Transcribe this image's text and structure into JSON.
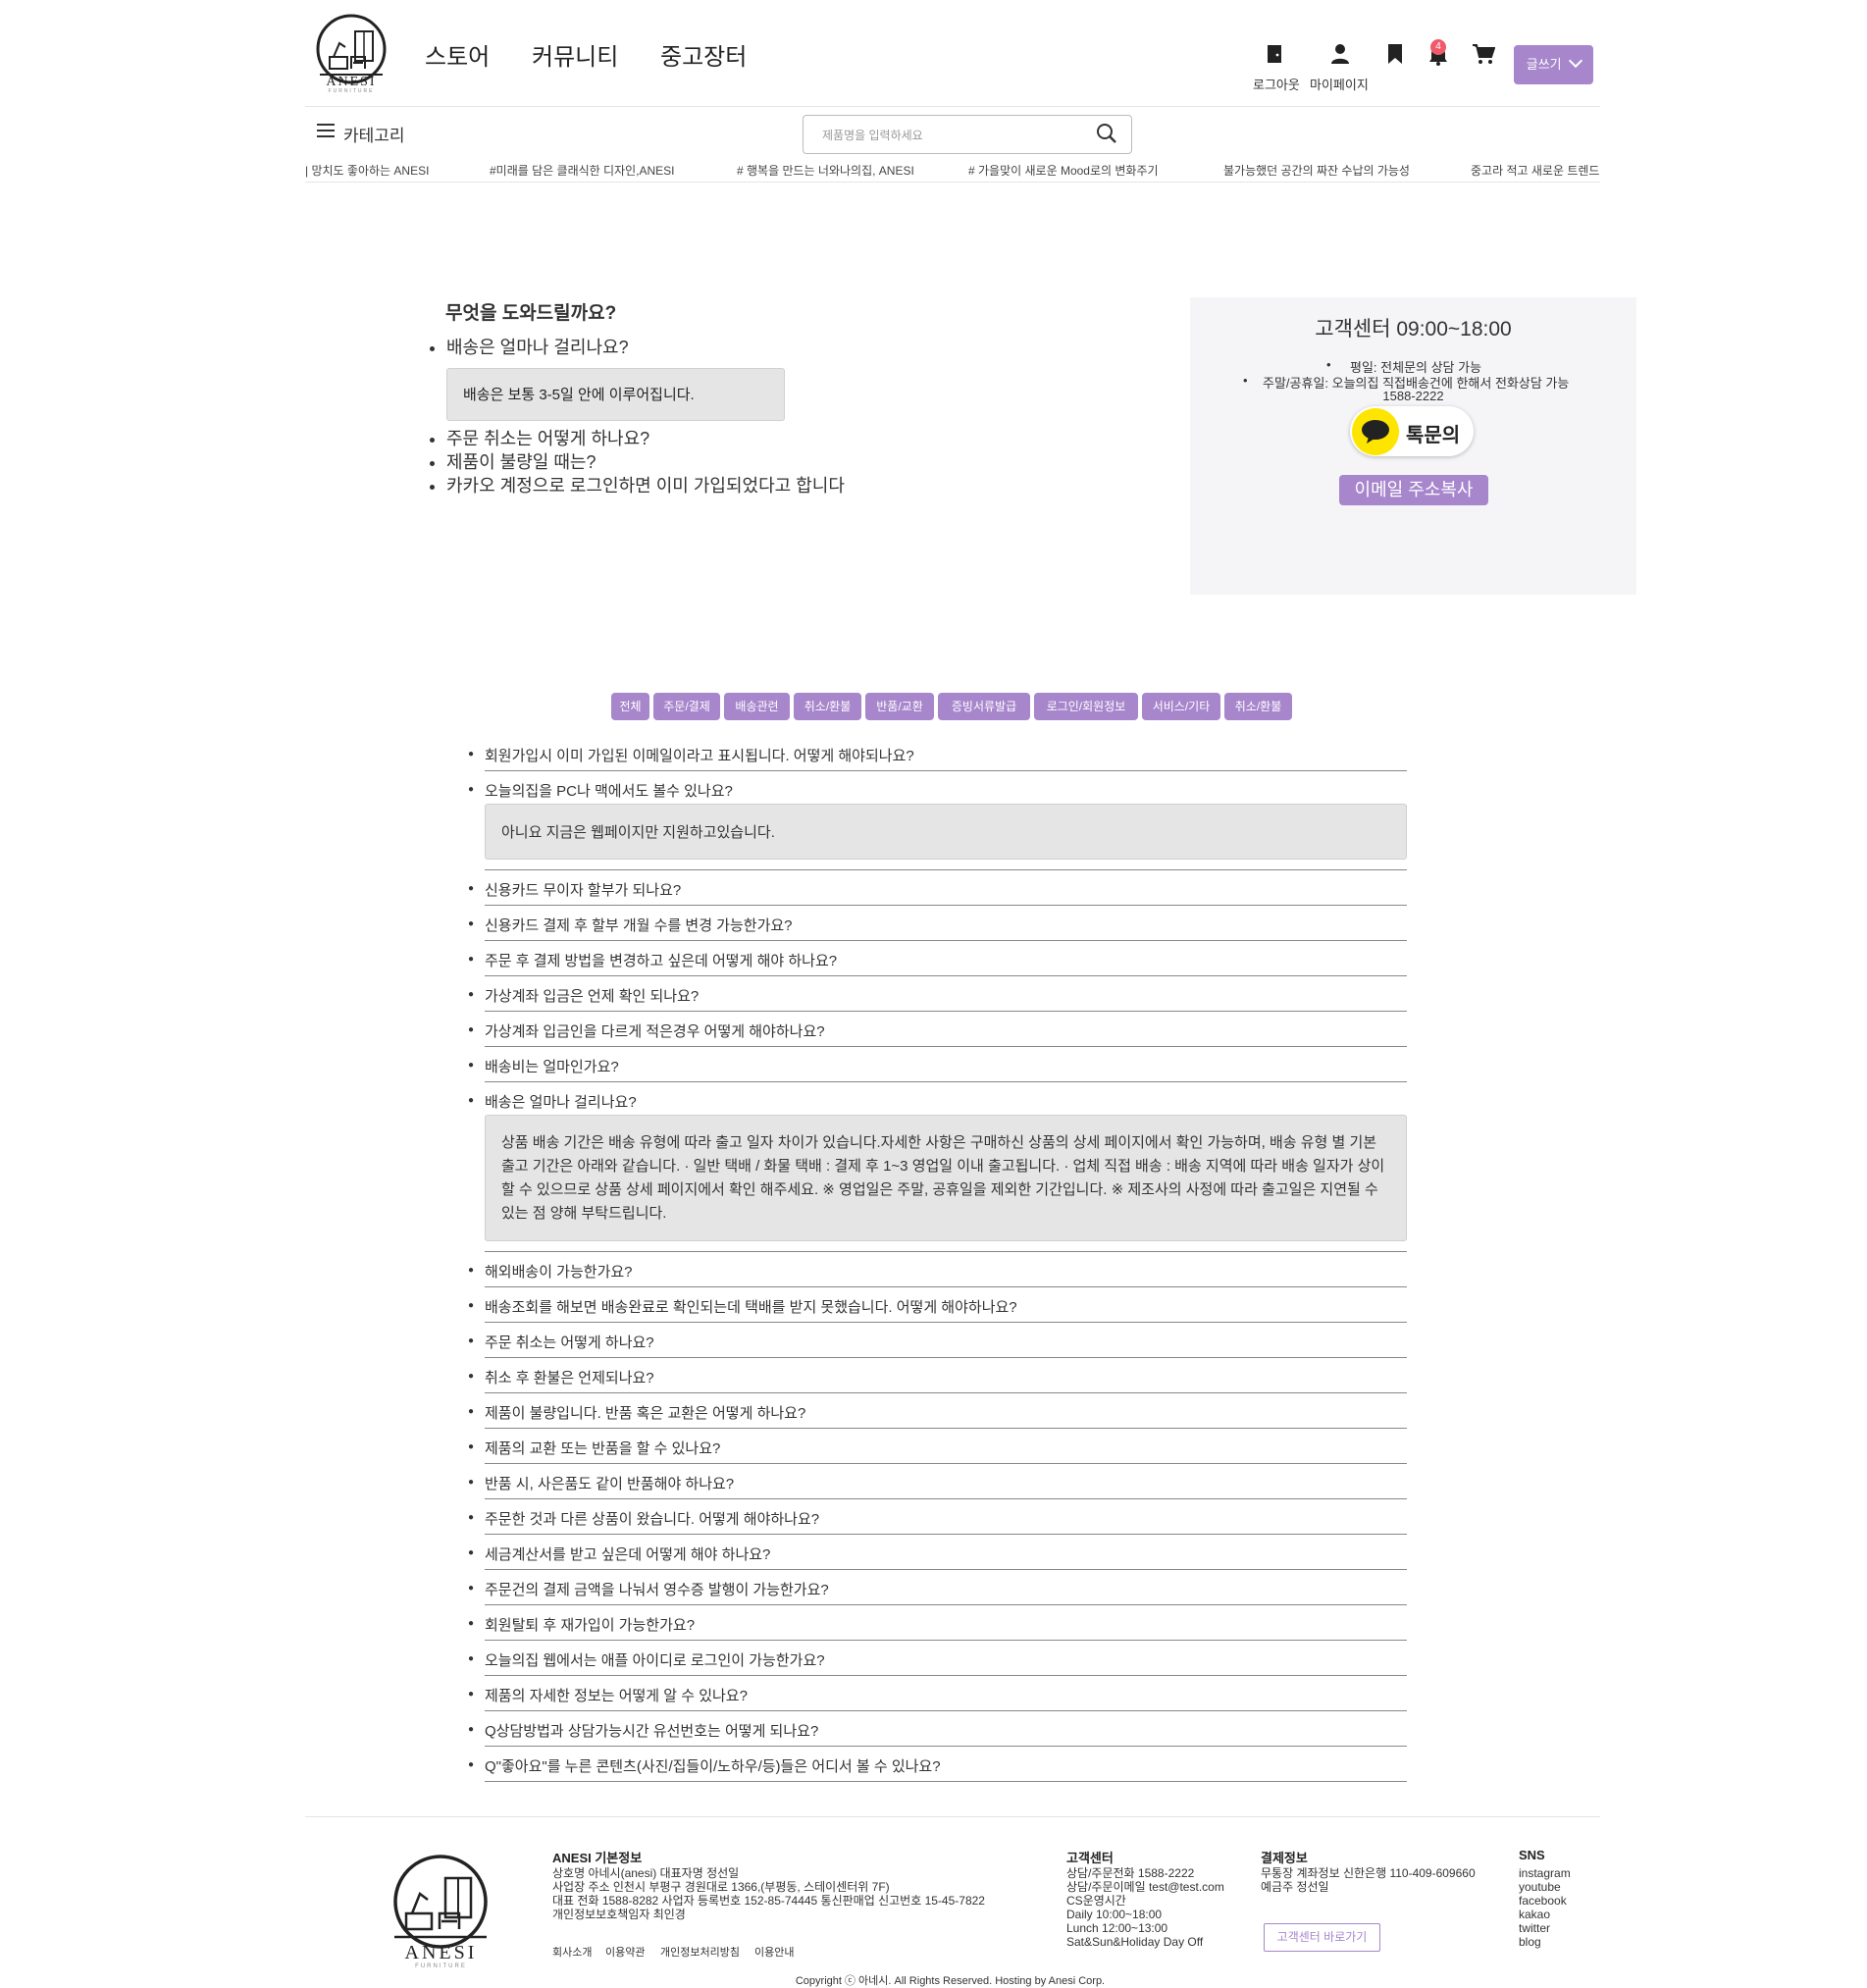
{
  "header": {
    "logo": "ANESI",
    "logo_sub": "FURNITURE",
    "nav": [
      "스토어",
      "커뮤니티",
      "중고장터"
    ],
    "logout_label": "로그아웃",
    "mypage_label": "마이페이지",
    "notification_count": "4",
    "write_label": "글쓰기"
  },
  "subbar": {
    "category_label": "카테고리",
    "search_placeholder": "제품명을 입력하세요",
    "marquee": [
      "| 망치도 좋아하는 ANESI",
      "#미래를 담은 클래식한 디자인,ANESI",
      "# 행복을 만드는 너와나의집, ANESI",
      "# 가을맞이 새로운 Mood로의 변화주기",
      "불가능했던 공간의 짜잔 수납의 가능성",
      "중고라 적고 새로운 트렌드"
    ]
  },
  "help": {
    "title": "무엇을 도와드릴까요?",
    "items": [
      {
        "q": "배송은 얼마나 걸리나요?",
        "a": "배송은 보통 3-5일 안에 이루어집니다."
      },
      {
        "q": "주문 취소는 어떻게 하나요?"
      },
      {
        "q": "제품이 불량일 때는?"
      },
      {
        "q": "카카오 계정으로 로그인하면 이미 가입되었다고 합니다"
      }
    ]
  },
  "cs": {
    "title": "고객센터 09:00~18:00",
    "weekday": "평일: 전체문의 상담 가능",
    "weekend": "주말/공휴일: 오늘의집 직접배송건에 한해서 전화상담 가능",
    "phone": "1588-2222",
    "kakao_label": "톡문의",
    "email_label": "이메일 주소복사"
  },
  "tabs": [
    "전체",
    "주문/결제",
    "배송관련",
    "취소/환불",
    "반품/교환",
    "증빙서류발급",
    "로그인/회원정보",
    "서비스/기타",
    "취소/환불"
  ],
  "faq": [
    {
      "q": "회원가입시 이미 가입된 이메일이라고 표시됩니다. 어떻게 해야되나요?"
    },
    {
      "q": "오늘의집을 PC나 맥에서도 볼수 있나요?",
      "a": "아니요 지금은 웹페이지만 지원하고있습니다."
    },
    {
      "q": "신용카드 무이자 할부가 되나요?"
    },
    {
      "q": "신용카드 결제 후 할부 개월 수를 변경 가능한가요?"
    },
    {
      "q": "주문 후 결제 방법을 변경하고 싶은데 어떻게 해야 하나요?"
    },
    {
      "q": "가상계좌 입금은 언제 확인 되나요?"
    },
    {
      "q": "가상계좌 입금인을 다르게 적은경우 어떻게 해야하나요?"
    },
    {
      "q": "배송비는 얼마인가요?"
    },
    {
      "q": "배송은 얼마나 걸리나요?",
      "a": "상품 배송 기간은 배송 유형에 따라 출고 일자 차이가 있습니다.자세한 사항은 구매하신 상품의 상세 페이지에서 확인 가능하며, 배송 유형 별 기본 출고 기간은 아래와 같습니다. · 일반 택배 / 화물 택배 : 결제 후 1~3 영업일 이내 출고됩니다. · 업체 직접 배송 : 배송 지역에 따라 배송 일자가 상이할 수 있으므로 상품 상세 페이지에서 확인 해주세요. ※ 영업일은 주말, 공휴일을 제외한 기간입니다. ※ 제조사의 사정에 따라 출고일은 지연될 수 있는 점 양해 부탁드립니다."
    },
    {
      "q": "해외배송이 가능한가요?"
    },
    {
      "q": "배송조회를 해보면 배송완료로 확인되는데 택배를 받지 못했습니다. 어떻게 해야하나요?"
    },
    {
      "q": "주문 취소는 어떻게 하나요?"
    },
    {
      "q": "취소 후 환불은 언제되나요?"
    },
    {
      "q": "제품이 불량입니다. 반품 혹은 교환은 어떻게 하나요?"
    },
    {
      "q": "제품의 교환 또는 반품을 할 수 있나요?"
    },
    {
      "q": "반품 시, 사은품도 같이 반품해야 하나요?"
    },
    {
      "q": "주문한 것과 다른 상품이 왔습니다. 어떻게 해야하나요?"
    },
    {
      "q": "세금계산서를 받고 싶은데 어떻게 해야 하나요?"
    },
    {
      "q": "주문건의 결제 금액을 나눠서 영수증 발행이 가능한가요?"
    },
    {
      "q": "회원탈퇴 후 재가입이 가능한가요?"
    },
    {
      "q": "오늘의집 웹에서는 애플 아이디로 로그인이 가능한가요?"
    },
    {
      "q": "제품의 자세한 정보는 어떻게 알 수 있나요?"
    },
    {
      "q": "Q상담방법과 상담가능시간 유선번호는 어떻게 되나요?"
    },
    {
      "q": "Q\"좋아요\"를 누른 콘텐츠(사진/집들이/노하우/등)들은 어디서 볼 수 있나요?"
    }
  ],
  "footer": {
    "logo": "ANESI",
    "logo_sub": "FURNITURE",
    "info_title": "ANESI 기본정보",
    "info_lines": [
      "상호명 아네시(anesi) 대표자명 정선일",
      "사업장 주소 인천시 부평구 경원대로 1366,(부평동, 스테이센터위 7F)",
      "대표 전화 1588-8282 사업자 등록번호 152-85-74445 통신판매업 신고번호 15-45-7822",
      "개인정보보호책임자 최인경"
    ],
    "links": [
      "회사소개",
      "이용약관",
      "개인정보처리방침",
      "이용안내"
    ],
    "cs_title": "고객센터",
    "cs_lines": [
      "상담/주문전화 1588-2222",
      "상담/주문이메일 test@test.com",
      "CS운영시간",
      "Daily 10:00~18:00",
      "Lunch 12:00~13:00",
      "Sat&Sun&Holiday Day Off"
    ],
    "pay_title": "결제정보",
    "pay_lines": [
      "무통장 계좌정보 신한은행 110-409-609660",
      "예금주 정선일"
    ],
    "cs_button": "고객센터 바로가기",
    "sns_title": "SNS",
    "sns": [
      "instagram",
      "youtube",
      "facebook",
      "kakao",
      "twitter",
      "blog"
    ],
    "copyright": "Copyright ⓒ 아네시. All Rights Reserved. Hosting by Anesi Corp."
  },
  "colors": {
    "accent": "#a786cc",
    "kakao": "#fee500",
    "badge": "#f05a6b"
  }
}
